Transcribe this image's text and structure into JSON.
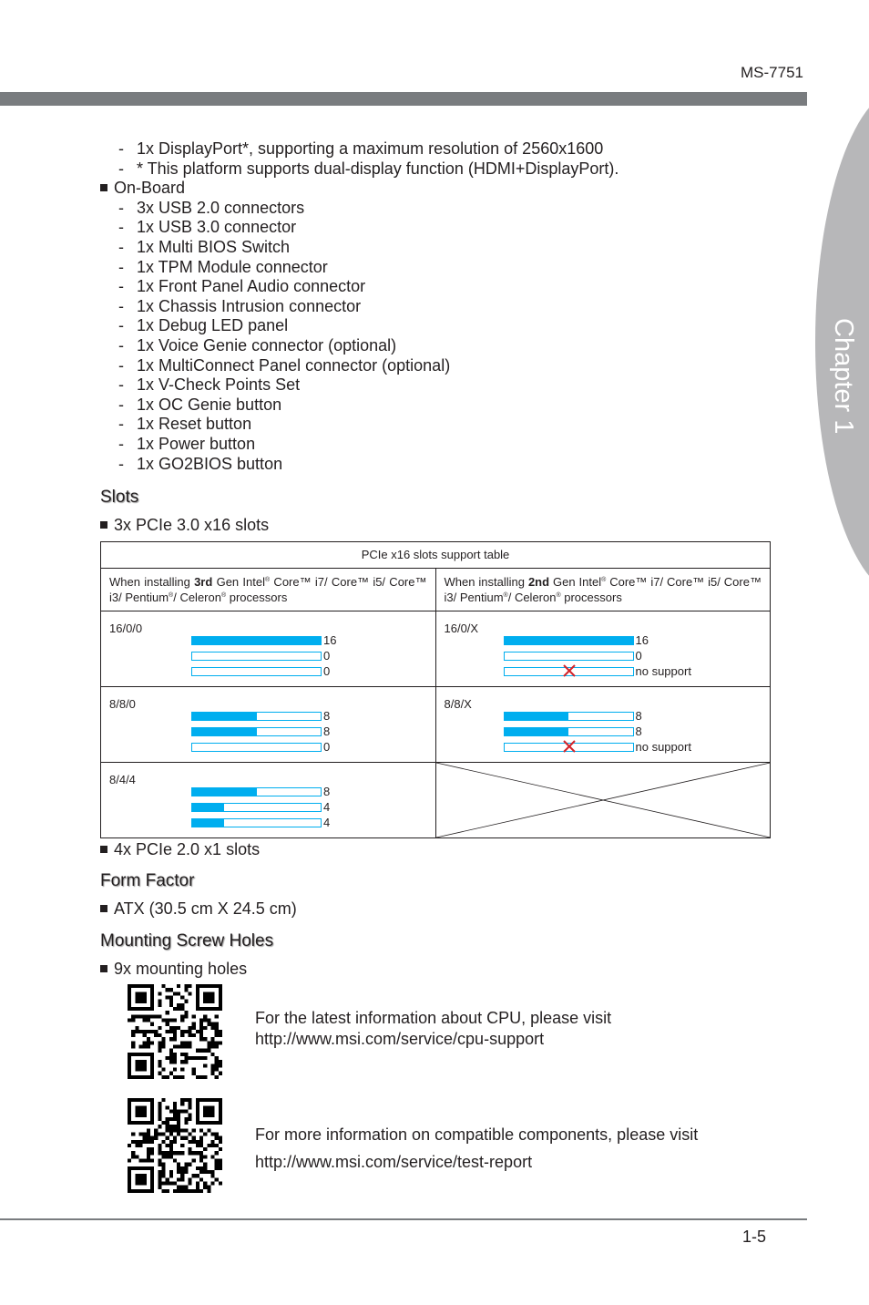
{
  "header": {
    "model": "MS-7751",
    "chapter": "Chapter 1"
  },
  "display_items": [
    "1x DisplayPort*, supporting a maximum resolution of 2560x1600",
    "* This platform supports dual-display function (HDMI+DisplayPort)."
  ],
  "onboard": {
    "label": "On-Board",
    "items": [
      "3x USB 2.0 connectors",
      "1x USB 3.0 connector",
      "1x Multi BIOS Switch",
      "1x TPM Module connector",
      "1x Front Panel Audio connector",
      "1x Chassis Intrusion connector",
      "1x Debug LED panel",
      "1x Voice Genie connector (optional)",
      "1x MultiConnect Panel connector (optional)",
      "1x V-Check Points Set",
      "1x OC Genie button",
      "1x Reset button",
      "1x Power button",
      "1x GO2BIOS button"
    ]
  },
  "slots": {
    "heading": "Slots",
    "pcie16_label": "3x PCIe 3.0 x16 slots",
    "pcie1_label": "4x PCIe 2.0 x1 slots",
    "table": {
      "title": "PCIe x16 slots support table",
      "max_lanes": 16,
      "columns": [
        {
          "prefix": "When installing ",
          "gen": "3rd",
          "suffix_a": " Gen Intel",
          "reg": "®",
          "suffix_b": " Core™ i7/ Core™ i5/ Core™ i3/ Pentium",
          "reg2": "®",
          "suffix_c": "/ Celeron",
          "reg3": "®",
          "suffix_d": " processors"
        },
        {
          "prefix": "When installing ",
          "gen": "2nd",
          "suffix_a": " Gen Intel",
          "reg": "®",
          "suffix_b": " Core™ i7/ Core™ i5/ Core™ i3/ Pentium",
          "reg2": "®",
          "suffix_c": "/ Celeron",
          "reg3": "®",
          "suffix_d": " processors"
        }
      ],
      "rows": [
        [
          {
            "label": "16/0/0",
            "lanes": [
              {
                "value": 16,
                "text": "16"
              },
              {
                "value": 0,
                "text": "0"
              },
              {
                "value": 0,
                "text": "0"
              }
            ]
          },
          {
            "label": "16/0/X",
            "lanes": [
              {
                "value": 16,
                "text": "16"
              },
              {
                "value": 0,
                "text": "0"
              },
              {
                "value": 0,
                "text": "no support",
                "unsupported": true
              }
            ]
          }
        ],
        [
          {
            "label": "8/8/0",
            "lanes": [
              {
                "value": 8,
                "text": "8"
              },
              {
                "value": 8,
                "text": "8"
              },
              {
                "value": 0,
                "text": "0"
              }
            ]
          },
          {
            "label": "8/8/X",
            "lanes": [
              {
                "value": 8,
                "text": "8"
              },
              {
                "value": 8,
                "text": "8"
              },
              {
                "value": 0,
                "text": "no support",
                "unsupported": true
              }
            ]
          }
        ],
        [
          {
            "label": "8/4/4",
            "lanes": [
              {
                "value": 8,
                "text": "8"
              },
              {
                "value": 4,
                "text": "4"
              },
              {
                "value": 4,
                "text": "4"
              }
            ]
          },
          null
        ]
      ]
    }
  },
  "form_factor": {
    "heading": "Form Factor",
    "item": "ATX (30.5 cm X 24.5 cm)"
  },
  "mounting": {
    "heading": "Mounting Screw Holes",
    "item": "9x mounting holes"
  },
  "links": [
    {
      "line1": "For the latest information about CPU, please visit",
      "line2": "http://www.msi.com/service/cpu-support"
    },
    {
      "line1": "For more information on compatible components, please visit",
      "line2": "http://www.msi.com/service/test-report"
    }
  ],
  "footer": {
    "page": "1-5"
  },
  "colors": {
    "lane_fill": "#00aeef",
    "no_support_x": "#d2232a",
    "header_bar": "#797c7f",
    "chapter_tab": "#b7b7b9"
  }
}
